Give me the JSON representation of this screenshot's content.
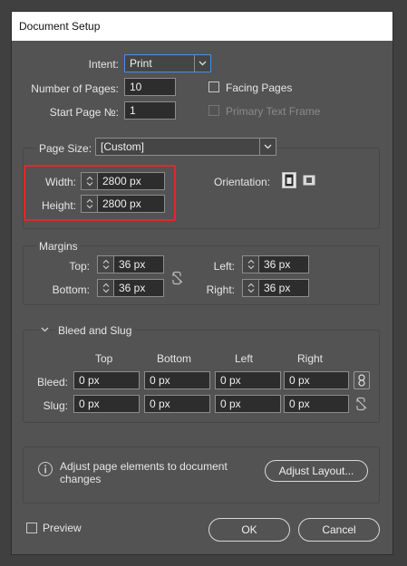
{
  "dialog": {
    "title": "Document Setup"
  },
  "intent": {
    "label": "Intent:",
    "value": "Print"
  },
  "pages": {
    "number_label": "Number of Pages:",
    "number_value": "10",
    "start_label": "Start Page №:",
    "start_value": "1",
    "facing_label": "Facing Pages",
    "facing_checked": false,
    "primary_label": "Primary Text Frame",
    "primary_enabled": false
  },
  "page_size": {
    "label": "Page Size:",
    "value": "[Custom]",
    "width_label": "Width:",
    "width_value": "2800 px",
    "height_label": "Height:",
    "height_value": "2800 px",
    "orientation_label": "Orientation:",
    "highlight_color": "#e3262d"
  },
  "margins": {
    "title": "Margins",
    "top_label": "Top:",
    "top_value": "36 px",
    "bottom_label": "Bottom:",
    "bottom_value": "36 px",
    "left_label": "Left:",
    "left_value": "36 px",
    "right_label": "Right:",
    "right_value": "36 px",
    "link_icon": "chain-broken-icon"
  },
  "bleed_slug": {
    "title": "Bleed and Slug",
    "columns": [
      "Top",
      "Bottom",
      "Left",
      "Right"
    ],
    "bleed_label": "Bleed:",
    "bleed_values": [
      "0 px",
      "0 px",
      "0 px",
      "0 px"
    ],
    "slug_label": "Slug:",
    "slug_values": [
      "0 px",
      "0 px",
      "0 px",
      "0 px"
    ]
  },
  "adjust": {
    "info_text": "Adjust page elements to document changes",
    "info_line1": "Adjust page elements to document",
    "info_line2": "changes",
    "button_label": "Adjust Layout..."
  },
  "footer": {
    "preview_label": "Preview",
    "ok_label": "OK",
    "cancel_label": "Cancel"
  }
}
